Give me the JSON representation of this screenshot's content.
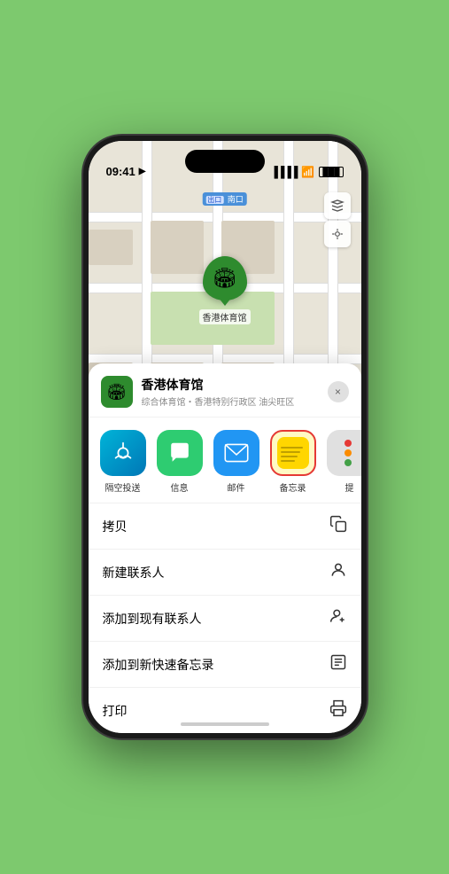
{
  "status_bar": {
    "time": "09:41",
    "location_icon": "▶",
    "signal": "▐▐▐▐",
    "wifi": "wifi",
    "battery": "battery"
  },
  "map": {
    "label": "南口",
    "label_prefix": "出口",
    "stadium_name": "香港体育馆",
    "layer_icon": "🗺",
    "location_icon": "⤴"
  },
  "bottom_sheet": {
    "venue_name": "香港体育馆",
    "venue_description": "综合体育馆・香港特别行政区 油尖旺区",
    "close_label": "×",
    "share_items": [
      {
        "id": "airdrop",
        "label": "隔空投送"
      },
      {
        "id": "messages",
        "label": "信息"
      },
      {
        "id": "mail",
        "label": "邮件"
      },
      {
        "id": "notes",
        "label": "备忘录"
      },
      {
        "id": "more",
        "label": "提"
      }
    ],
    "action_items": [
      {
        "id": "copy",
        "label": "拷贝",
        "icon": "copy"
      },
      {
        "id": "new-contact",
        "label": "新建联系人",
        "icon": "person"
      },
      {
        "id": "add-existing",
        "label": "添加到现有联系人",
        "icon": "person-add"
      },
      {
        "id": "add-notes",
        "label": "添加到新快速备忘录",
        "icon": "notes"
      },
      {
        "id": "print",
        "label": "打印",
        "icon": "print"
      }
    ]
  }
}
